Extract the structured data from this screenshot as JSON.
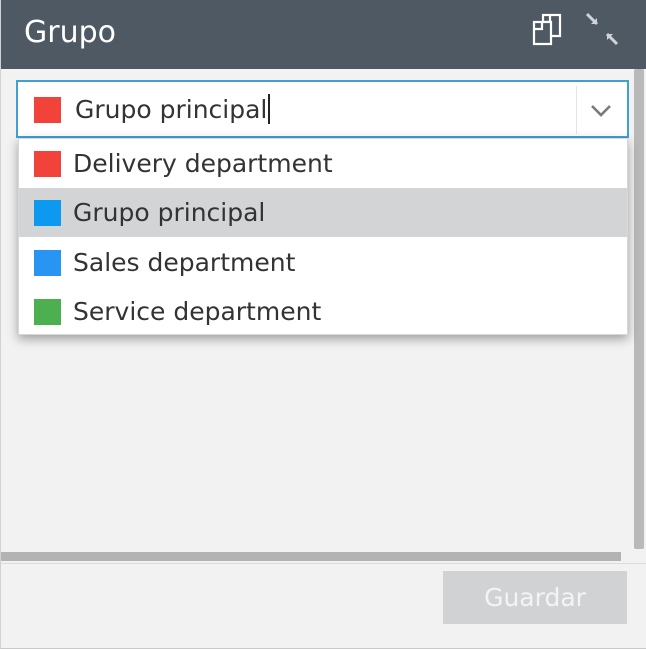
{
  "dialog": {
    "title": "Grupo",
    "header_bg": "#4f5964",
    "icons": [
      "restore-window-icon",
      "minimize-window-icon"
    ]
  },
  "group_combo": {
    "value": "Grupo principal",
    "color": "#f2433a",
    "focus_border": "#3da1d8",
    "icon": "chevron-down-icon"
  },
  "group_options": [
    {
      "label": "Delivery department",
      "color": "#f2433a",
      "selected": false
    },
    {
      "label": "Grupo principal",
      "color": "#0d99f0",
      "selected": true
    },
    {
      "label": "Sales department",
      "color": "#2995f3",
      "selected": false
    },
    {
      "label": "Service department",
      "color": "#4caf50",
      "selected": false
    }
  ],
  "footer": {
    "save_label": "Guardar",
    "save_enabled": false
  }
}
